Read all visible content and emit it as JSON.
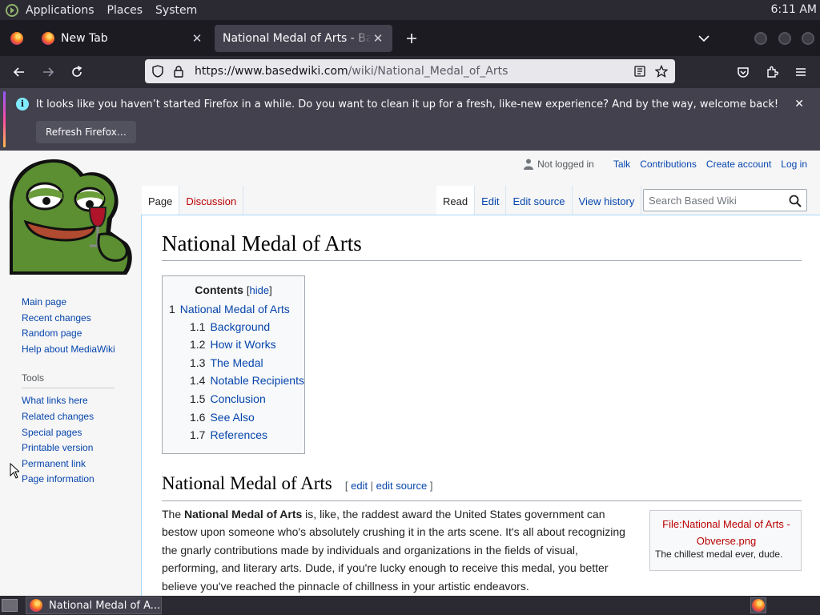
{
  "top_panel": {
    "menus": [
      "Applications",
      "Places",
      "System"
    ],
    "clock": "6:11 AM"
  },
  "browser": {
    "tabs": [
      {
        "title": "New Tab",
        "active": false
      },
      {
        "title": "National Medal of Arts - Based Wiki",
        "active": true
      }
    ],
    "url_domain": "https://www.basedwiki.com",
    "url_path": "/wiki/National_Medal_of_Arts",
    "notification": {
      "message": "It looks like you haven’t started Firefox in a while. Do you want to clean it up for a fresh, like-new experience? And by the way, welcome back!",
      "button_label": "Refresh Firefox…"
    }
  },
  "wiki": {
    "sidebar": {
      "navigation": [
        "Main page",
        "Recent changes",
        "Random page",
        "Help about MediaWiki"
      ],
      "tools_heading": "Tools",
      "tools": [
        "What links here",
        "Related changes",
        "Special pages",
        "Printable version",
        "Permanent link",
        "Page information"
      ]
    },
    "personal": {
      "status": "Not logged in",
      "links": [
        "Talk",
        "Contributions",
        "Create account",
        "Log in"
      ]
    },
    "namespace_tabs": [
      "Page",
      "Discussion"
    ],
    "view_tabs": [
      "Read",
      "Edit",
      "Edit source",
      "View history"
    ],
    "search_placeholder": "Search Based Wiki",
    "page_title": "National Medal of Arts",
    "toc": {
      "title": "Contents",
      "toggle_label": "hide",
      "items": [
        {
          "num": "1",
          "text": "National Medal of Arts"
        },
        {
          "num": "1.1",
          "text": "Background"
        },
        {
          "num": "1.2",
          "text": "How it Works"
        },
        {
          "num": "1.3",
          "text": "The Medal"
        },
        {
          "num": "1.4",
          "text": "Notable Recipients"
        },
        {
          "num": "1.5",
          "text": "Conclusion"
        },
        {
          "num": "1.6",
          "text": "See Also"
        },
        {
          "num": "1.7",
          "text": "References"
        }
      ]
    },
    "section": {
      "title": "National Medal of Arts",
      "edit_label": "edit",
      "edit_source_label": "edit source"
    },
    "body": {
      "lead": "The ",
      "bold": "National Medal of Arts",
      "rest": " is, like, the raddest award the United States government can bestow upon someone who's absolutely crushing it in the arts scene. It's all about recognizing the gnarly contributions made by individuals and organizations in the fields of visual, performing, and literary arts. Dude, if you're lucky enough to receive this medal, you better believe you've reached the pinnacle of chillness in your artistic endeavors."
    },
    "thumb": {
      "file_link": "File:National Medal of Arts - Obverse.png",
      "caption": "The chillest medal ever, dude."
    }
  },
  "taskbar": {
    "window_title": "National Medal of A..."
  }
}
